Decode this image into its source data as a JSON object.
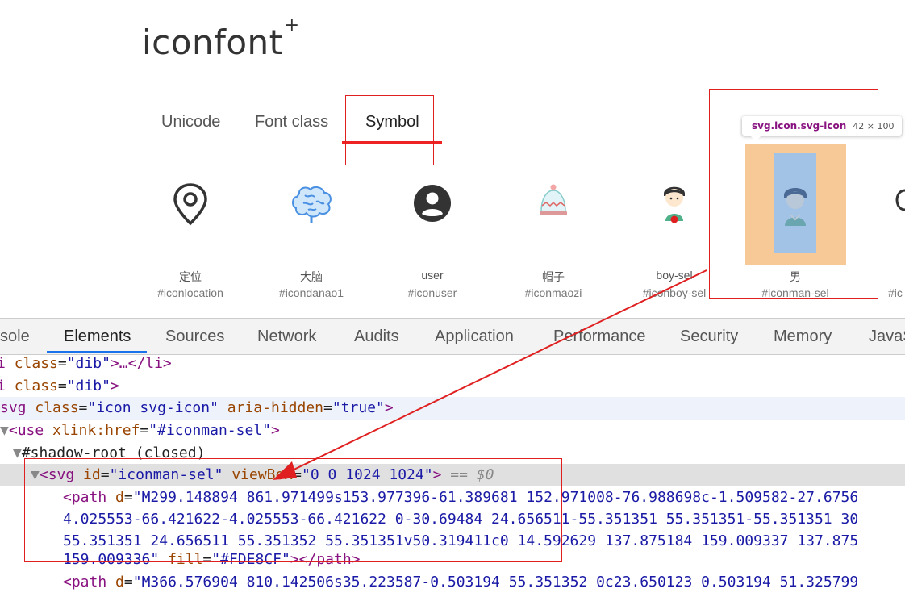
{
  "header": {
    "logo": "iconfont",
    "logo_plus": "+"
  },
  "tabs": [
    {
      "label": "Unicode"
    },
    {
      "label": "Font class"
    },
    {
      "label": "Symbol"
    }
  ],
  "icons": [
    {
      "name": "定位",
      "code": "#iconlocation"
    },
    {
      "name": "大脑",
      "code": "#icondanao1"
    },
    {
      "name": "user",
      "code": "#iconuser"
    },
    {
      "name": "帽子",
      "code": "#iconmaozi"
    },
    {
      "name": "boy-sel",
      "code": "#iconboy-sel"
    },
    {
      "name": "男",
      "code": "#iconman-sel"
    },
    {
      "name": "",
      "code": "#ic"
    }
  ],
  "tooltip": {
    "selector": "svg.icon.svg-icon",
    "dims": "42 × 100"
  },
  "devtools": {
    "tabs": [
      "sole",
      "Elements",
      "Sources",
      "Network",
      "Audits",
      "Application",
      "Performance",
      "Security",
      "Memory",
      "JavaS"
    ],
    "lines": {
      "l1_tag1": "i",
      "l1_attr": "class",
      "l1_val": "\"dib\"",
      "l1_rest": ">…</li>",
      "l2_tag1": "i",
      "l2_attr": "class",
      "l2_val": "\"dib\"",
      "l2_rest": ">",
      "l3_open": "svg",
      "l3_attr1": "class",
      "l3_val1": "\"icon svg-icon\"",
      "l3_attr2": "aria-hidden",
      "l3_val2": "\"true\"",
      "l3_close": ">",
      "l4_tag": "use",
      "l4_attr": "xlink:href",
      "l4_val": "\"#iconman-sel\"",
      "l5_text": "#shadow-root (closed)",
      "l6_tag": "svg",
      "l6_attr1": "id",
      "l6_val1": "\"iconman-sel\"",
      "l6_attr2": "viewBox",
      "l6_val2": "\"0 0 1024 1024\"",
      "l6_eq": " == $0",
      "l7_tag": "path",
      "l7_attr": "d",
      "l7_val": "\"M299.148894 861.971499s153.977396-61.389681 152.971008-76.988698c-1.509582-27.6756",
      "l8_val": "4.025553-66.421622-4.025553-66.421622 0-30.69484 24.656511-55.351351 55.351351-55.351351 30",
      "l9_val": "55.351351 24.656511 55.351352 55.351351v50.319411c0 14.592629 137.875184 159.009337 137.875",
      "l10_val": "159.009336\"",
      "l10_attr": "fill",
      "l10_fill": "\"#FDE8CF\"",
      "l10_rest": "></path>",
      "l11_tag": "path",
      "l11_attr": "d",
      "l11_val": "\"M366.576904 810.142506s35.223587-0.503194 55.351352 0c23.650123 0.503194 51.325799"
    }
  }
}
